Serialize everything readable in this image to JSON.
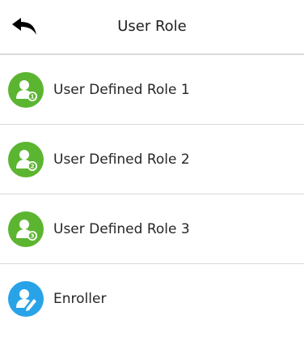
{
  "header": {
    "title": "User Role",
    "back_icon": "back-arrow-icon"
  },
  "roles": [
    {
      "label": "User Defined Role 1",
      "icon": "user-role-1-icon",
      "color": "#5cb531",
      "badge": "1"
    },
    {
      "label": "User Defined Role 2",
      "icon": "user-role-2-icon",
      "color": "#5cb531",
      "badge": "2"
    },
    {
      "label": "User Defined Role 3",
      "icon": "user-role-3-icon",
      "color": "#5cb531",
      "badge": "3"
    },
    {
      "label": "Enroller",
      "icon": "enroller-icon",
      "color": "#29a3e8",
      "badge": ""
    }
  ],
  "colors": {
    "divider": "#d9d9d9",
    "text": "#262626",
    "role_green": "#5cb531",
    "enroller_blue": "#29a3e8"
  }
}
